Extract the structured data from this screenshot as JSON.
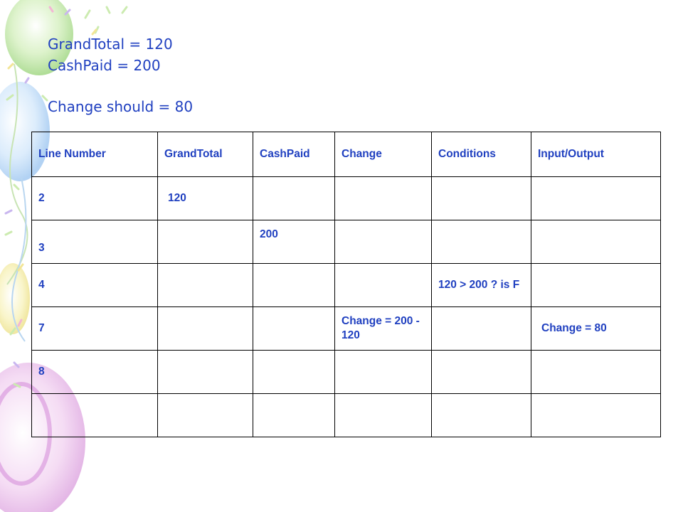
{
  "title_lines": {
    "grand_total": "GrandTotal = 120",
    "cash_paid": "CashPaid = 200",
    "change_should": "Change should = 80"
  },
  "table": {
    "headers": [
      "Line Number",
      "GrandTotal",
      "CashPaid",
      "Change",
      "Conditions",
      "Input/Output"
    ],
    "rows": [
      [
        "2",
        "120",
        "",
        "",
        "",
        ""
      ],
      [
        "3",
        "",
        "200",
        "",
        "",
        ""
      ],
      [
        "4",
        "",
        "",
        "",
        "120 > 200 ? is F",
        ""
      ],
      [
        "7",
        "",
        "",
        "Change = 200 - 120",
        "",
        "Change = 80"
      ],
      [
        "8",
        "",
        "",
        "",
        "",
        ""
      ],
      [
        "",
        "",
        "",
        "",
        "",
        ""
      ]
    ]
  },
  "colors": {
    "text": "#2040c0",
    "border": "#000000"
  }
}
